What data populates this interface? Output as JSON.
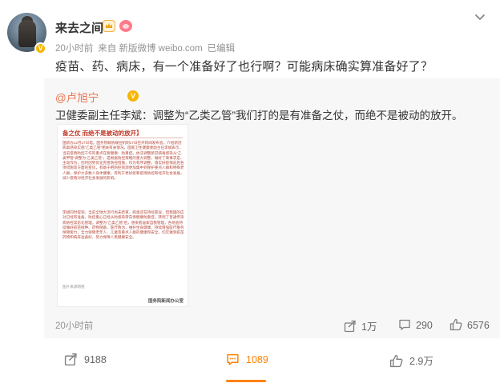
{
  "post": {
    "username": "来去之间",
    "time": "20小时前",
    "source": "来自 新版微博 weibo.com",
    "edited": "已编辑",
    "text": "疫苗、药、病床，有一个准备好了也行啊？可能病床确实算准备好了？",
    "icons": {
      "verified": "v-badge-icon",
      "level": "crown-icon",
      "member": "bunny-icon",
      "menu": "chevron-down-icon"
    }
  },
  "repost": {
    "author": "@卢旭宁",
    "text": "卫健委副主任李斌：调整为“乙类乙管”我们打的是有准备之仗，而绝不是被动的放开。",
    "time": "20小时前",
    "shares": "1万",
    "comments": "290",
    "likes": "6576",
    "image": {
      "title": "备之仗 而绝不是被动的放开】",
      "para1": "国新办12月27日电，国务院联防联控机制27日召开新闻发布会，介绍新冠病毒感染实施“乙类乙管”相关有关情况。国家卫生健康委副主任李斌表示，当前疫情防控工作的重点在要健康、防重症。依法调整新冠病毒感染从“乙类甲管”调整为“乙类乙管”，是根据防控策略的重大调整，做好了来事求是、主动作为，因时因势优化完善防控措施，作为有序调整，落实好疫情前后各项措施等方面的变化，有助于把防控资源更加集中到保护重点人群和特殊老人群，保护大多数人身体健康，有利于更好统筹疫情防控和经济社会发展，减少疫情对经济社会发展的影响。",
      "para2": "李斌同时提到，当前全球大流行尚未结束，病毒还在持续变异，但我国的应对已经有准备，防控重心已经从防感染转向保健康防重症，转到了普通传染病防控常态化管理，调整为“乙类乙管”后，感染者居家自我管理，各地会持续做好疫苗接种、药物储备、医疗救治，维护生命健康，持续增强医疗服务保障能力，全力保障老年人、儿童等重点人群的健康和安全，切实做到疫苗药物和病床准备好，努力保障人民健康安全。",
      "source": "图片来源网络",
      "logo": "国务院新闻办公室"
    },
    "icons": {
      "verified": "v-badge-icon",
      "share": "share-icon",
      "comment": "comment-icon",
      "like": "like-icon"
    }
  },
  "actions": {
    "share": "9188",
    "comment": "1089",
    "like": "2.9万",
    "icons": {
      "share": "share-icon",
      "comment": "comment-icon",
      "like": "like-icon"
    }
  },
  "colors": {
    "accent": "#ff8200",
    "link": "#eb7350",
    "verified": "#f7b500",
    "repost_bg": "#f7f7f7",
    "article_red": "#c23a2a"
  }
}
